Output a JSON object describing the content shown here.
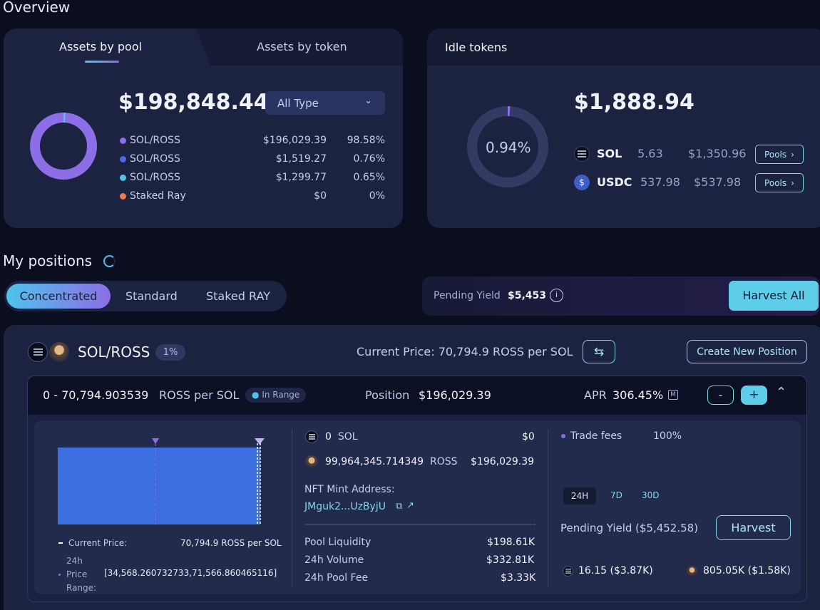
{
  "overview": {
    "title": "Overview",
    "tabs": [
      "Assets by pool",
      "Assets by token"
    ],
    "total": "$198,848.44",
    "type_select": "All Type",
    "colors": {
      "accent": "#8c6ee6",
      "blue": "#4e67e6",
      "cyan": "#4fc3ea",
      "orange": "#f07a4a"
    },
    "pools": [
      {
        "name": "SOL/ROSS",
        "value": "$196,029.39",
        "pct": "98.58%",
        "color": "#8c6ee6"
      },
      {
        "name": "SOL/ROSS",
        "value": "$1,519.27",
        "pct": "0.76%",
        "color": "#4e67e6"
      },
      {
        "name": "SOL/ROSS",
        "value": "$1,299.77",
        "pct": "0.65%",
        "color": "#4fc3ea"
      },
      {
        "name": "Staked Ray",
        "value": "$0",
        "pct": "0%",
        "color": "#f07a4a"
      }
    ],
    "donut_fraction": 0.9858
  },
  "idle": {
    "title": "Idle tokens",
    "total": "$1,888.94",
    "pct": "0.94%",
    "pct_fraction": 0.0094,
    "tokens": [
      {
        "symbol": "SOL",
        "amount": "5.63",
        "value": "$1,350.96",
        "button": "Pools",
        "icon": "solana-icon"
      },
      {
        "symbol": "USDC",
        "amount": "537.98",
        "value": "$537.98",
        "button": "Pools",
        "icon": "usdc-icon"
      }
    ]
  },
  "positions": {
    "title": "My positions",
    "tabs": [
      "Concentrated",
      "Standard",
      "Staked RAY"
    ],
    "pending_label": "Pending Yield",
    "pending_value": "$5,453",
    "harvest_all": "Harvest All"
  },
  "pool": {
    "name": "SOL/ROSS",
    "fee_badge": "1%",
    "current_price": "Current Price: 70,794.9 ROSS per SOL",
    "create_button": "Create New Position",
    "range_value": "0 - 70,794.903539",
    "range_unit": "ROSS per SOL",
    "in_range": "In Range",
    "position_label": "Position",
    "position_value": "$196,029.39",
    "apr_label": "APR",
    "apr_value": "306.45%",
    "apr_badge": "M",
    "minus": "-",
    "plus": "+",
    "chart_legend": {
      "current_label": "Current Price:",
      "current_value": "70,794.9",
      "current_unit": "ROSS per SOL",
      "range_label_1": "24h",
      "range_label_2": "Price",
      "range_label_3": "Range:",
      "range_value": "[34,568.260732733,71,566.860465116]"
    },
    "tokens": [
      {
        "amount": "0",
        "symbol": "SOL",
        "value": "$0"
      },
      {
        "amount": "99,964,345.714349",
        "symbol": "ROSS",
        "value": "$196,029.39"
      }
    ],
    "nft_label": "NFT Mint Address:",
    "nft_value": "JMguk2...UzByjU",
    "stats": [
      {
        "label": "Pool Liquidity",
        "value": "$198.61K"
      },
      {
        "label": "24h Volume",
        "value": "$332.81K"
      },
      {
        "label": "24h Pool Fee",
        "value": "$3.33K"
      }
    ],
    "trade_fees_label": "Trade fees",
    "trade_fees_value": "100%",
    "periods": [
      "24H",
      "7D",
      "30D"
    ],
    "pending_label": "Pending Yield",
    "pending_value": "($5,452.58)",
    "harvest": "Harvest",
    "rewards": [
      {
        "value": "16.15 ($3.87K)"
      },
      {
        "value": "805.05K ($1.58K)"
      }
    ]
  }
}
